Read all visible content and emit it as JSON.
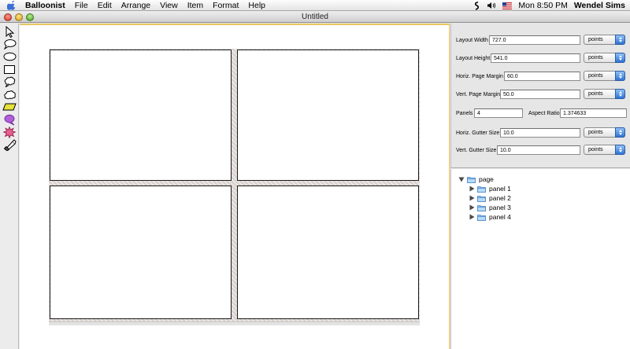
{
  "menubar": {
    "app_name": "Balloonist",
    "menus": [
      "File",
      "Edit",
      "Arrange",
      "View",
      "Item",
      "Format",
      "Help"
    ],
    "clock": "Mon 8:50 PM",
    "user": "Wendel Sims"
  },
  "window": {
    "title": "Untitled"
  },
  "tools": [
    "arrow-tool-icon",
    "speech-balloon-tool-icon",
    "oval-tool-icon",
    "rectangle-tool-icon",
    "thought-balloon-tool-icon",
    "cloud-tool-icon",
    "caption-tool-icon",
    "whisper-balloon-tool-icon",
    "burst-tool-icon",
    "cap-tool-icon"
  ],
  "inspector": {
    "layout_width": {
      "label": "Layout Width",
      "value": "727.0",
      "unit": "points"
    },
    "layout_height": {
      "label": "Layout Height",
      "value": "541.0",
      "unit": "points"
    },
    "horiz_margin": {
      "label": "Horiz. Page Margin",
      "value": "60.0",
      "unit": "points"
    },
    "vert_margin": {
      "label": "Vert. Page Margin",
      "value": "50.0",
      "unit": "points"
    },
    "panels": {
      "label": "Panels",
      "value": "4"
    },
    "aspect_ratio": {
      "label": "Aspect Ratio",
      "value": "1.374633"
    },
    "horiz_gutter": {
      "label": "Horiz. Gutter Size",
      "value": "10.0",
      "unit": "points"
    },
    "vert_gutter": {
      "label": "Vert. Gutter Size",
      "value": "10.0",
      "unit": "points"
    }
  },
  "outline": {
    "root": "page",
    "children": [
      "panel 1",
      "panel 2",
      "panel 3",
      "panel 4"
    ]
  },
  "colors": {
    "accent": "#3a7bd5",
    "canvas_border": "#e8c660"
  }
}
